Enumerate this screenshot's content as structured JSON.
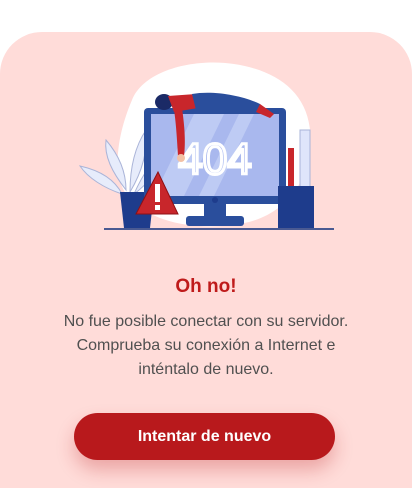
{
  "illustration": {
    "icon": "error-404-computer-illustration",
    "screen_text": "404"
  },
  "error": {
    "title": "Oh no!",
    "message": "No fue posible conectar con su servidor. Comprueba su conexión a Internet e inténtalo de nuevo."
  },
  "actions": {
    "retry_label": "Intentar de nuevo"
  },
  "colors": {
    "background": "#ffdcd9",
    "accent": "#b8191c",
    "title": "#bf1b1b",
    "body_text": "#505050"
  }
}
